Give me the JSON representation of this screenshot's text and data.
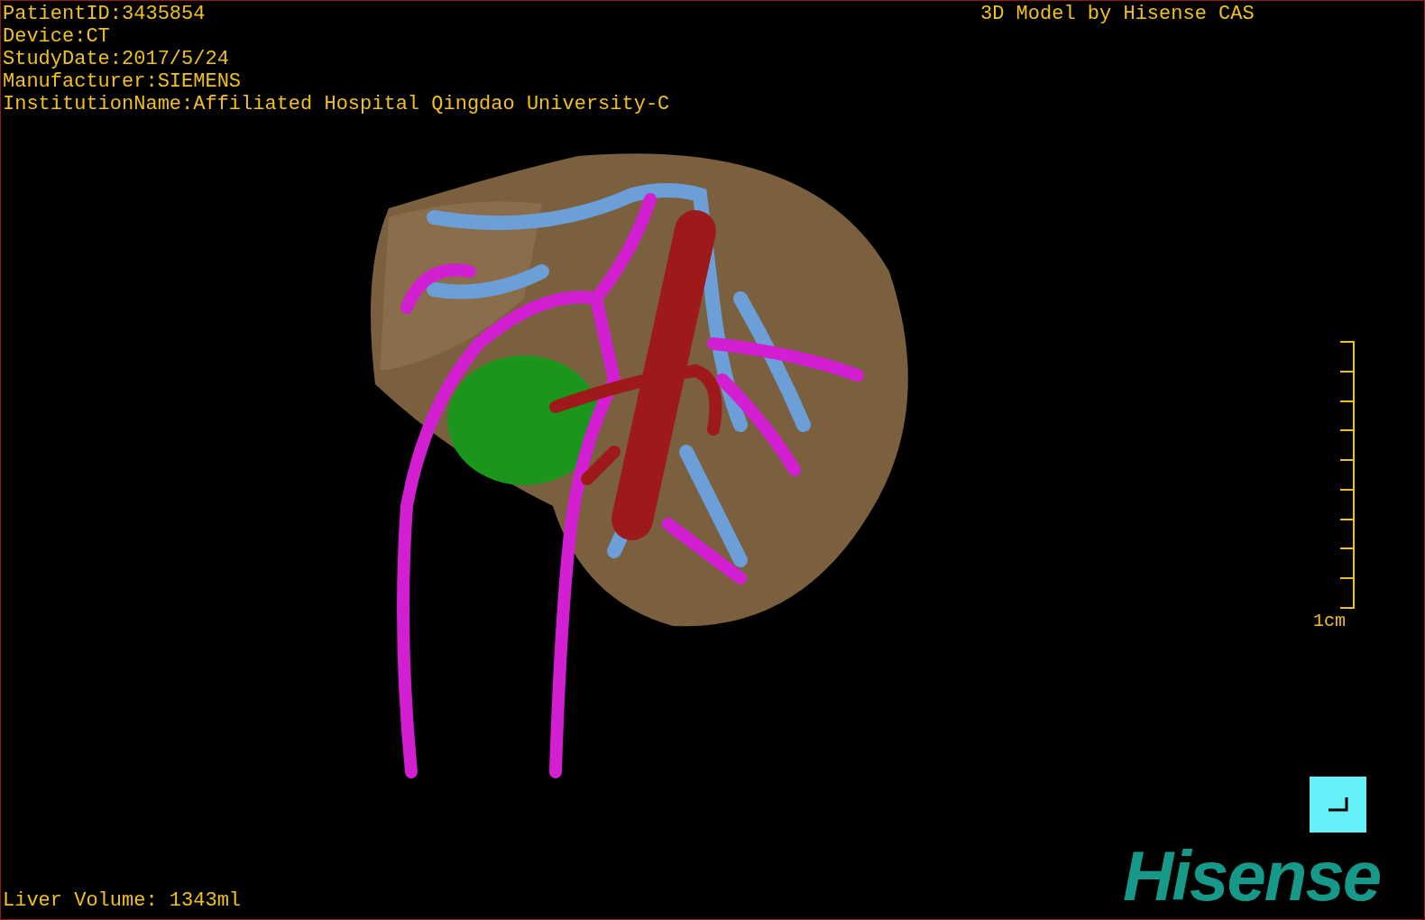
{
  "header_lines": [
    "PatientID:3435854",
    "Device:CT",
    "StudyDate:2017/5/24",
    "Manufacturer:SIEMENS",
    "InstitutionName:Affiliated Hospital Qingdao University-C"
  ],
  "model_credit": "3D Model by Hisense CAS",
  "scale_bar": {
    "label": "1cm"
  },
  "liver_volume": "Liver Volume: 1343ml",
  "logo": "Hisense"
}
